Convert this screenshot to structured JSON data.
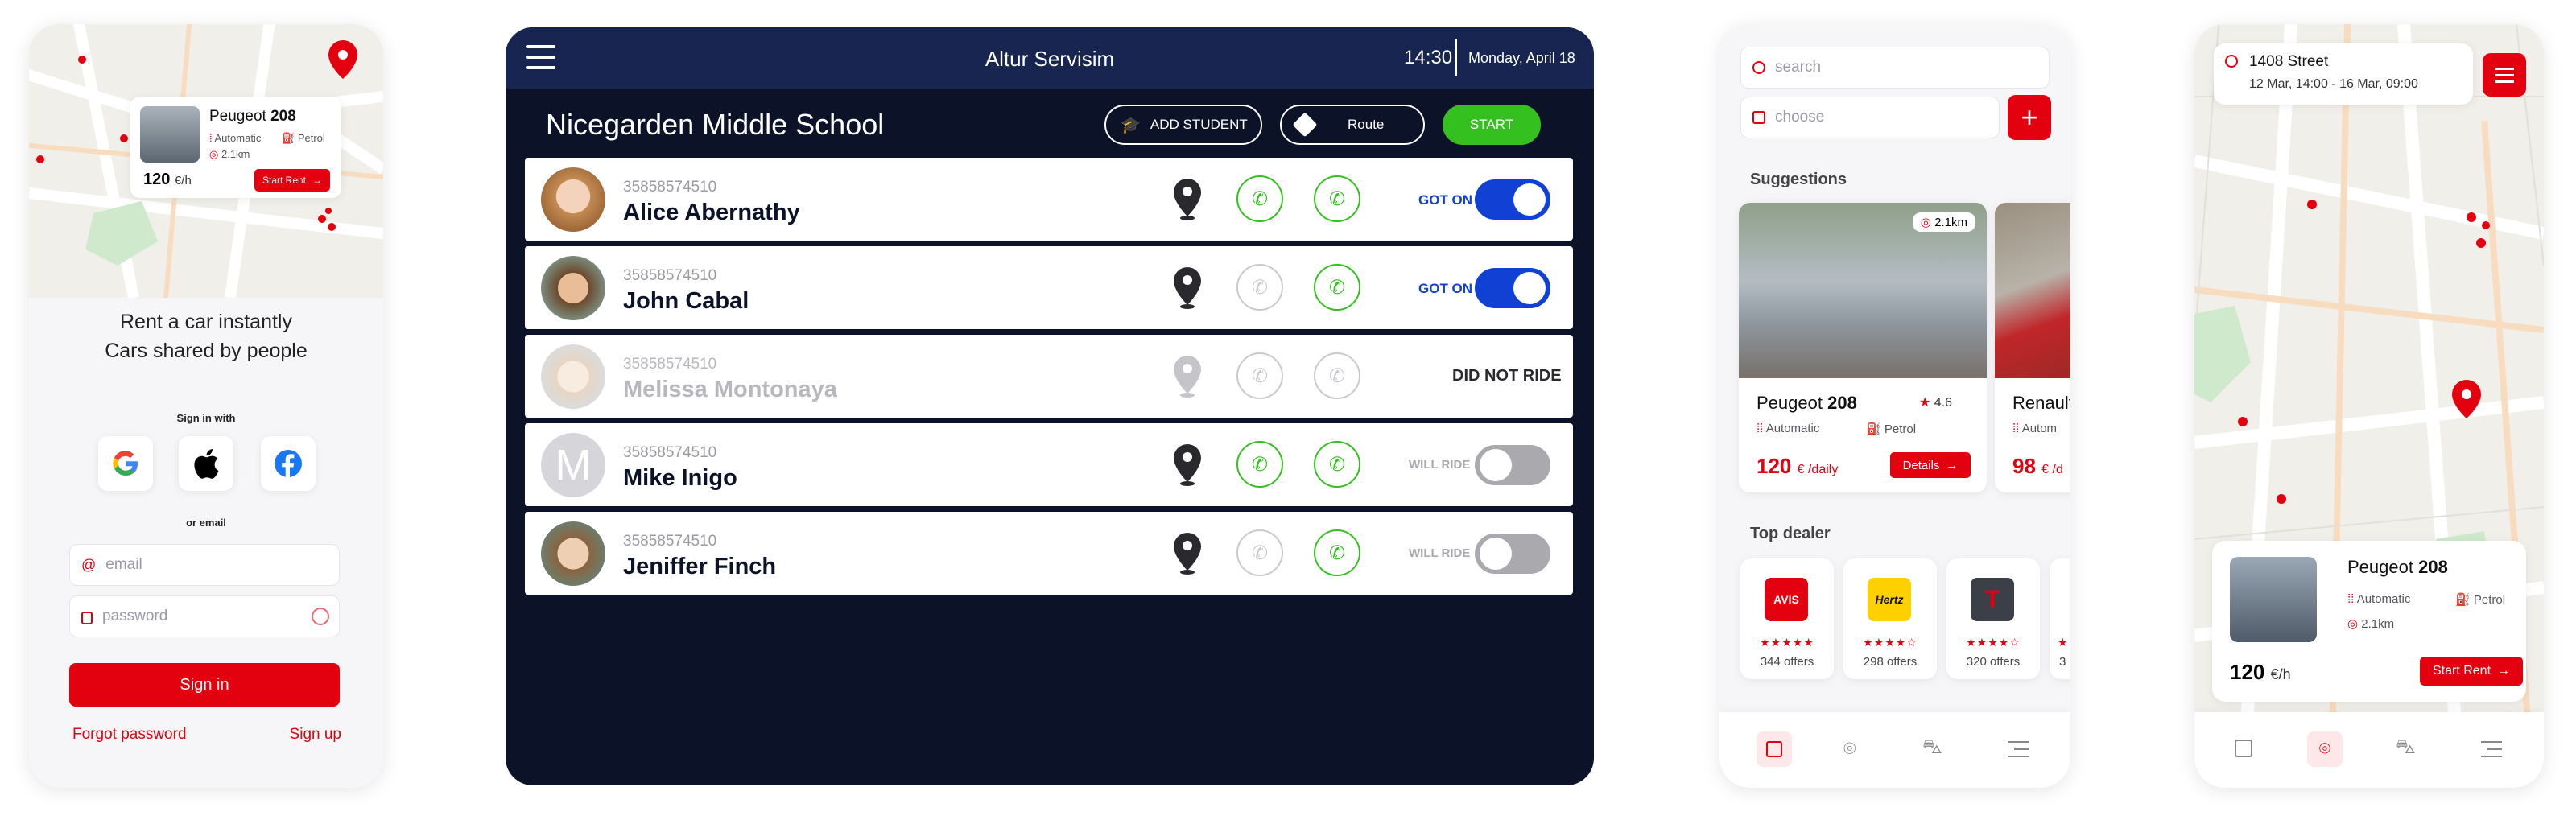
{
  "colors": {
    "red": "#e3000f",
    "navy": "#0c1329",
    "green": "#34c01f",
    "blue": "#1040d4"
  },
  "login": {
    "map_card": {
      "car_model": "Peugeot",
      "car_number": "208",
      "transmission": "Automatic",
      "fuel": "Petrol",
      "distance": "2.1km",
      "price": "120",
      "price_unit": "€/h",
      "button": "Start Rent"
    },
    "tagline_1": "Rent a car instantly",
    "tagline_2": "Cars shared by people",
    "signin_with": "Sign in with",
    "or_email": "or email",
    "email_placeholder": "email",
    "password_placeholder": "password",
    "signin_button": "Sign in",
    "forgot": "Forgot password",
    "signup": "Sign up"
  },
  "tablet": {
    "title": "Altur Servisim",
    "time": "14:30",
    "date": "Monday, April 18",
    "school": "Nicegarden Middle School",
    "add_student": "ADD STUDENT",
    "route": "Route",
    "start": "START",
    "rows": [
      {
        "id": "35858574510",
        "name": "Alice Abernathy",
        "status": "GOT ON"
      },
      {
        "id": "35858574510",
        "name": "John Cabal",
        "status": "GOT ON"
      },
      {
        "id": "35858574510",
        "name": "Melissa Montonaya",
        "status": "DID NOT RIDE"
      },
      {
        "id": "35858574510",
        "name": "Mike Inigo",
        "status": "WILL RIDE",
        "initial": "M"
      },
      {
        "id": "35858574510",
        "name": "Jeniffer Finch",
        "status": "WILL RIDE"
      }
    ]
  },
  "search": {
    "search_placeholder": "search",
    "choose_placeholder": "choose",
    "suggestions_title": "Suggestions",
    "cars": [
      {
        "model": "Peugeot",
        "number": "208",
        "rating": "4.6",
        "distance": "2.1km",
        "transmission": "Automatic",
        "fuel": "Petrol",
        "price": "120",
        "unit": "€ /daily",
        "button": "Details"
      },
      {
        "model": "Renault",
        "transmission": "Autom",
        "price": "98",
        "unit": "€ /d"
      }
    ],
    "dealer_title": "Top dealer",
    "dealers": [
      {
        "name": "AVIS",
        "offers": "344 offers",
        "stars": 5
      },
      {
        "name": "Hertz",
        "offers": "298 offers",
        "stars": 4
      },
      {
        "name": "T",
        "offers": "320 offers",
        "stars": 4
      },
      {
        "name": "",
        "offers": "3",
        "stars": 1
      }
    ]
  },
  "mapview": {
    "street": "1408 Street",
    "dates": "12 Mar, 14:00 - 16 Mar, 09:00",
    "car_model": "Peugeot",
    "car_number": "208",
    "transmission": "Automatic",
    "fuel": "Petrol",
    "distance": "2.1km",
    "price": "120",
    "price_unit": "€/h",
    "button": "Start Rent"
  }
}
